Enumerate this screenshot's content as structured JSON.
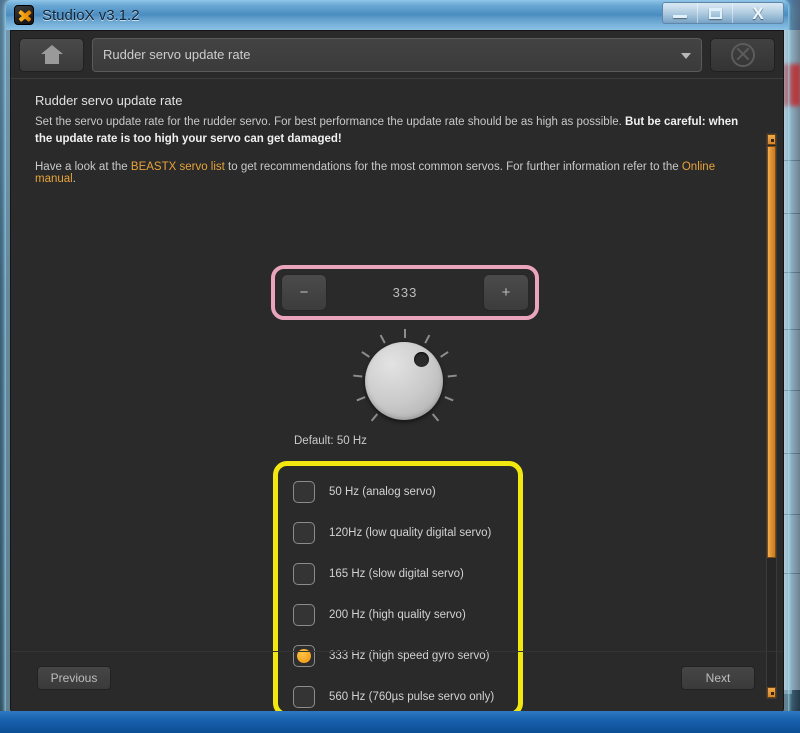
{
  "window": {
    "title": "StudioX v3.1.2",
    "app_icon": "studiox-x-logo-icon",
    "controls": {
      "minimize": "minimize-icon",
      "maximize": "maximize-icon",
      "close": "X"
    }
  },
  "background_window": {
    "title_obscured": "",
    "note": "blurred background window title"
  },
  "toolbar": {
    "home_icon": "home-icon",
    "page_select_value": "Rudder servo update rate",
    "page_select_caret": "chevron-down-icon",
    "abort_icon": "circle-x-disconnect-icon"
  },
  "content": {
    "heading": "Rudder servo update rate",
    "description_normal": "Set the servo update rate for the rudder servo. For best performance the update rate should be as high as possible. ",
    "description_bold": "But be careful: when the update rate is too high your servo can get damaged!",
    "links_prefix": "Have a look at the ",
    "link_servo_list": "BEASTX servo list",
    "links_middle": " to get recommendations for the most common servos. For further information refer to the ",
    "link_manual": "Online manual",
    "links_suffix": "."
  },
  "stepper": {
    "decrement_label": "−",
    "value": "333",
    "increment_label": "+",
    "highlight_color": "#eaa5bd"
  },
  "knob": {
    "name": "rotary-knob",
    "indicator_position": "upper-right"
  },
  "default_label": "Default: 50 Hz",
  "options": {
    "highlight_color": "#f2e80f",
    "selected_index": 4,
    "items": [
      {
        "label": "50 Hz (analog servo)",
        "selected": false
      },
      {
        "label": "120Hz (low quality digital servo)",
        "selected": false
      },
      {
        "label": "165 Hz (slow digital servo)",
        "selected": false
      },
      {
        "label": "200 Hz (high quality servo)",
        "selected": false
      },
      {
        "label": "333 Hz (high speed gyro servo)",
        "selected": true
      },
      {
        "label": "560 Hz (760µs pulse servo only)",
        "selected": false
      }
    ]
  },
  "scrollbar": {
    "up_arrow": "scroll-up-arrow-icon",
    "down_arrow": "scroll-down-arrow-icon",
    "thumb_color": "#e0912f"
  },
  "footer": {
    "previous_label": "Previous",
    "next_label": "Next"
  }
}
